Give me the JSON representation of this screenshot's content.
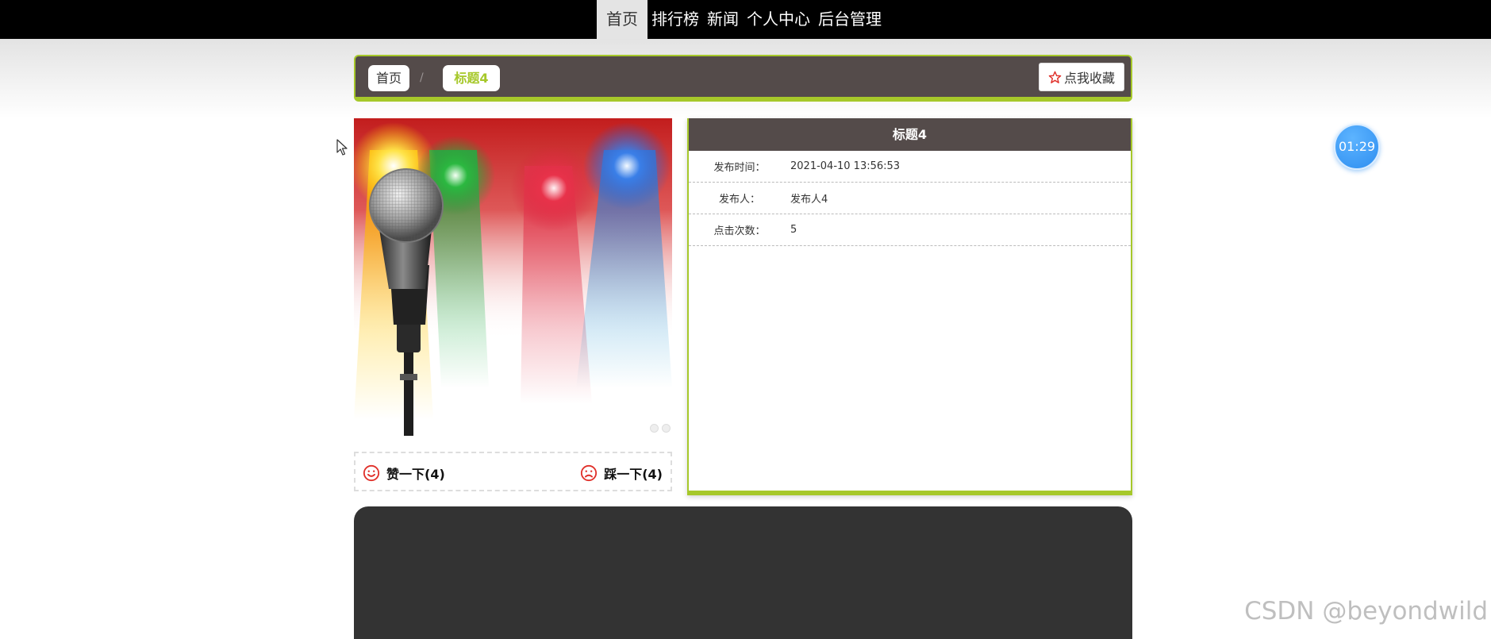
{
  "nav": {
    "items": [
      {
        "label": "首页",
        "active": true
      },
      {
        "label": "排行榜",
        "active": false
      },
      {
        "label": "新闻",
        "active": false
      },
      {
        "label": "个人中心",
        "active": false
      },
      {
        "label": "后台管理",
        "active": false
      }
    ]
  },
  "breadcrumb": {
    "home": "首页",
    "separator": "/",
    "current": "标题4",
    "favorite_label": "点我收藏"
  },
  "detail": {
    "title": "标题4",
    "rows": [
      {
        "label": "发布时间：",
        "value": "2021-04-10 13:56:53"
      },
      {
        "label": "发布人：",
        "value": "发布人4"
      },
      {
        "label": "点击次数：",
        "value": "5"
      }
    ]
  },
  "votes": {
    "like_label": "赞一下(4)",
    "dislike_label": "踩一下(4)"
  },
  "timer": {
    "value": "01:29"
  },
  "watermark": "CSDN @beyondwild",
  "colors": {
    "nav_bg": "#000000",
    "panel_dark": "#544b4a",
    "accent_green": "#a6c82a",
    "footer_dark": "#333333",
    "timer_blue": "#2e8ef0",
    "vote_red": "#e0302a"
  }
}
